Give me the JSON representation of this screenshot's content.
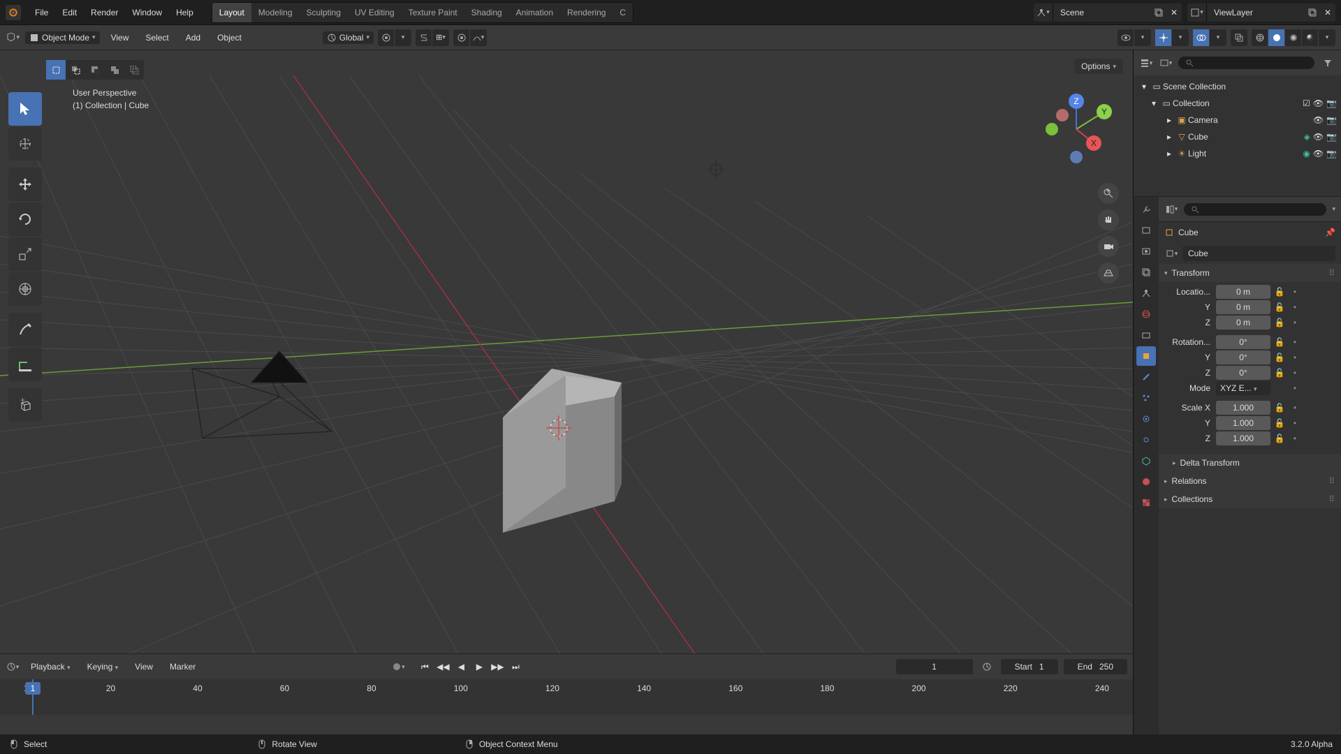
{
  "topmenu": {
    "items": [
      "File",
      "Edit",
      "Render",
      "Window",
      "Help"
    ]
  },
  "tabs": {
    "items": [
      "Layout",
      "Modeling",
      "Sculpting",
      "UV Editing",
      "Texture Paint",
      "Shading",
      "Animation",
      "Rendering",
      "C"
    ],
    "active": "Layout"
  },
  "scene": {
    "name": "Scene"
  },
  "viewlayer": {
    "name": "ViewLayer"
  },
  "secondbar": {
    "mode": "Object Mode",
    "menus": [
      "View",
      "Select",
      "Add",
      "Object"
    ],
    "orientation": "Global",
    "options_label": "Options"
  },
  "viewport": {
    "perspective": "User Perspective",
    "context": "(1) Collection | Cube"
  },
  "outliner": {
    "root": "Scene Collection",
    "collection": "Collection",
    "items": [
      "Camera",
      "Cube",
      "Light"
    ]
  },
  "properties": {
    "object_name": "Cube",
    "data_name": "Cube",
    "transform_label": "Transform",
    "location_label": "Locatio...",
    "rotation_label": "Rotation...",
    "mode_label": "Mode",
    "mode_value": "XYZ E...",
    "scale_label": "Scale X",
    "location": {
      "x": "0 m",
      "y": "0 m",
      "z": "0 m",
      "yl": "Y",
      "zl": "Z"
    },
    "rotation": {
      "x": "0°",
      "y": "0°",
      "z": "0°",
      "yl": "Y",
      "zl": "Z"
    },
    "scale": {
      "x": "1.000",
      "y": "1.000",
      "z": "1.000",
      "yl": "Y",
      "zl": "Z"
    },
    "delta_label": "Delta Transform",
    "relations_label": "Relations",
    "collections_label": "Collections"
  },
  "timeline": {
    "playback": "Playback",
    "keying": "Keying",
    "menus": [
      "View",
      "Marker"
    ],
    "current": "1",
    "start_label": "Start",
    "start": "1",
    "end_label": "End",
    "end": "250",
    "ticks": [
      "1",
      "20",
      "40",
      "60",
      "80",
      "100",
      "120",
      "140",
      "160",
      "180",
      "200",
      "220",
      "240"
    ]
  },
  "status": {
    "select": "Select",
    "rotate": "Rotate View",
    "ctx": "Object Context Menu",
    "version": "3.2.0 Alpha"
  },
  "gizmo_axes": {
    "x": "X",
    "y": "Y",
    "z": "Z"
  }
}
